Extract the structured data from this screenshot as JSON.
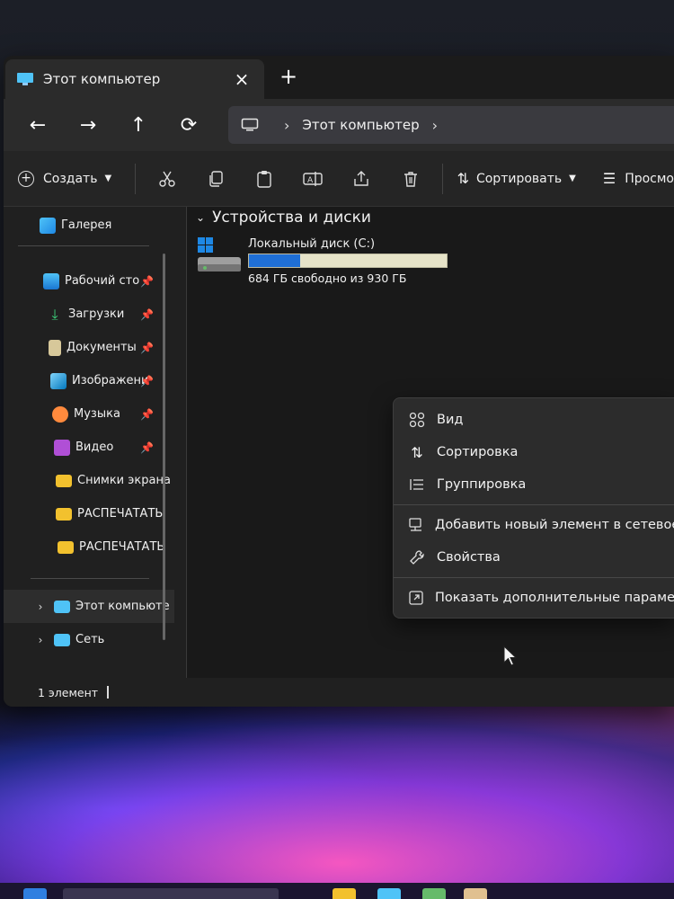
{
  "window": {
    "tab_title": "Этот компьютер",
    "tab_close": "×",
    "new_tab": "+"
  },
  "navigation": {
    "back": "←",
    "forward": "→",
    "up": "↑",
    "refresh": "⟳",
    "address_separator": "›",
    "address_path": "Этот компьютер",
    "address_trailing_chevron": "›"
  },
  "toolbar": {
    "create_label": "Создать",
    "icons": [
      "cut-icon",
      "copy-icon",
      "paste-icon",
      "rename-icon",
      "share-icon",
      "delete-icon"
    ],
    "sort_label": "Сортировать",
    "view_label": "Просмо"
  },
  "sidebar": {
    "gallery": "Галерея",
    "pinned": [
      {
        "label": "Рабочий сто",
        "icon": "desktop-icon",
        "pinned": true
      },
      {
        "label": "Загрузки",
        "icon": "downloads-icon",
        "pinned": true
      },
      {
        "label": "Документы",
        "icon": "documents-icon",
        "pinned": true
      },
      {
        "label": "Изображени",
        "icon": "pictures-icon",
        "pinned": true
      },
      {
        "label": "Музыка",
        "icon": "music-icon",
        "pinned": true
      },
      {
        "label": "Видео",
        "icon": "videos-icon",
        "pinned": true
      },
      {
        "label": "Снимки экрана",
        "icon": "folder-icon",
        "pinned": false
      },
      {
        "label": "РАСПЕЧАТАТЬ",
        "icon": "folder-icon",
        "pinned": false
      },
      {
        "label": "РАСПЕЧАТАТЬ",
        "icon": "folder-icon",
        "pinned": false
      }
    ],
    "this_pc": "Этот компьюте",
    "network": "Сеть"
  },
  "content": {
    "group_title": "Устройства и диски",
    "drive_name": "Локальный диск (C:)",
    "drive_free_text": "684 ГБ свободно из 930 ГБ",
    "drive_used_fraction": 0.26
  },
  "status": {
    "item_count": "1 элемент"
  },
  "context_menu": {
    "items": [
      {
        "label": "Вид",
        "icon": "grid-view-icon"
      },
      {
        "label": "Сортировка",
        "icon": "sort-icon"
      },
      {
        "label": "Группировка",
        "icon": "group-icon"
      },
      {
        "label": "Добавить новый элемент в сетевое",
        "icon": "network-location-icon"
      },
      {
        "label": "Свойства",
        "icon": "wrench-icon"
      },
      {
        "label": "Показать дополнительные параметр",
        "icon": "more-options-icon"
      }
    ]
  },
  "colors": {
    "accent": "#1f6fd6",
    "folder": "#f2c12e",
    "window_bg": "#202020"
  }
}
